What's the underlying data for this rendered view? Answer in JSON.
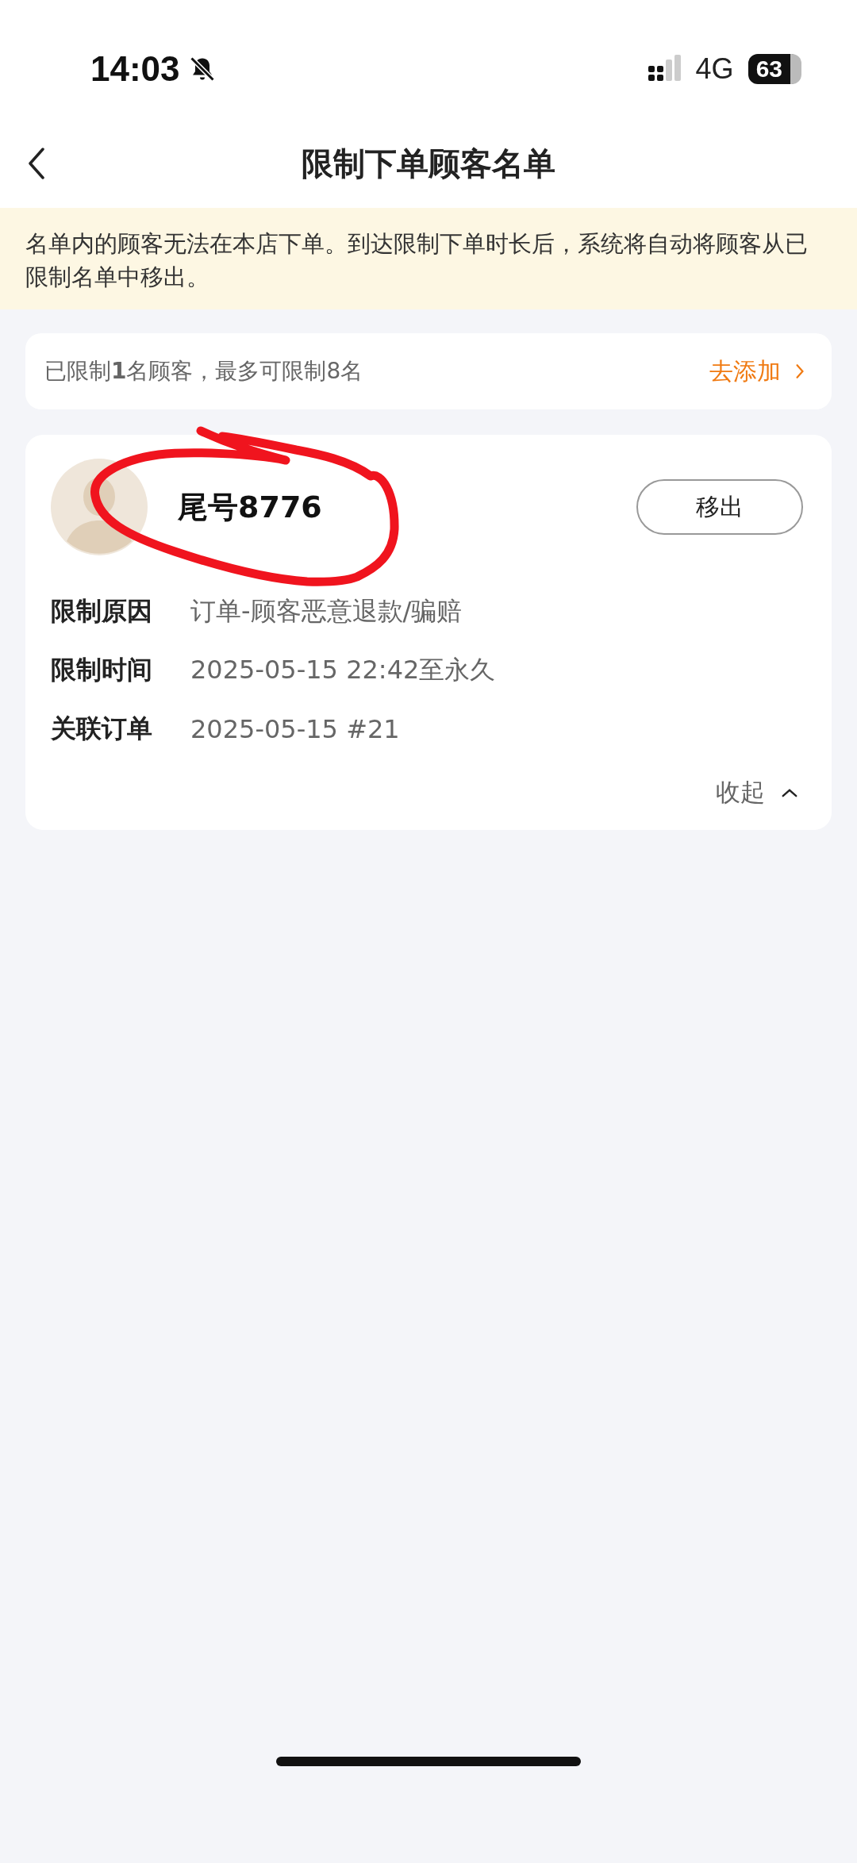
{
  "status_bar": {
    "time": "14:03",
    "network": "4G",
    "battery": "63"
  },
  "nav": {
    "title": "限制下单顾客名单"
  },
  "notice": "名单内的顾客无法在本店下单。到达限制下单时长后，系统将自动将顾客从已限制名单中移出。",
  "summary": {
    "text": "已限制**1**名顾客，最多可限制8名",
    "action": "去添加"
  },
  "customers": [
    {
      "name": "尾号8776",
      "button": "移出",
      "expanded": true,
      "fields": [
        {
          "label": "限制原因",
          "value": "订单-顾客恶意退款/骗赔"
        },
        {
          "label": "限制时间",
          "value": "2025-05-15 22:42至永久"
        },
        {
          "label": "关联订单",
          "value": "2025-05-15 #21"
        }
      ],
      "toggle": "收起"
    }
  ]
}
